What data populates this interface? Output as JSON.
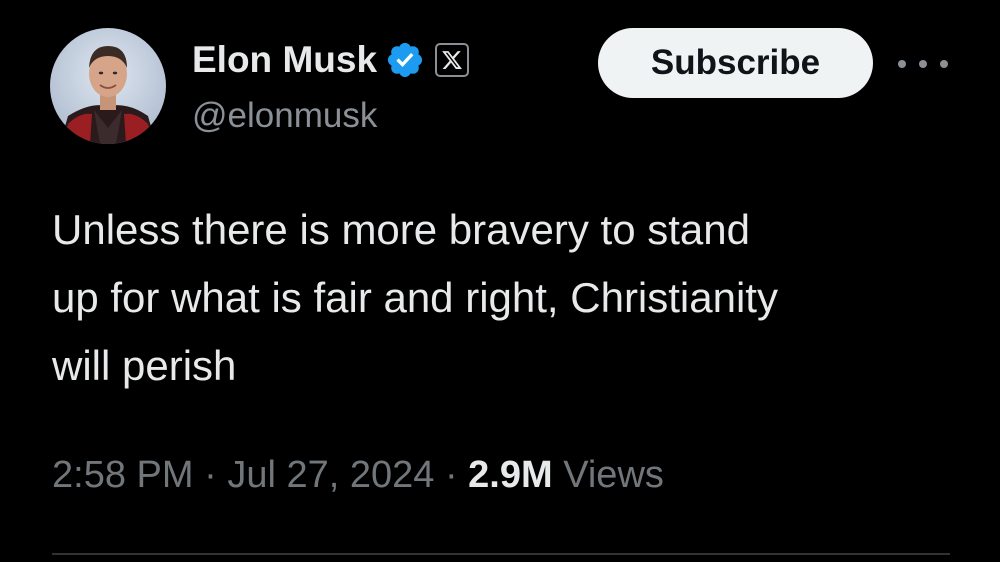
{
  "author": {
    "display_name": "Elon Musk",
    "handle": "@elonmusk",
    "avatar_icon": "profile-photo",
    "verified_icon": "verified-badge-icon",
    "affiliate_icon": "x-logo-icon"
  },
  "actions": {
    "subscribe_label": "Subscribe",
    "more_icon": "more-options-icon"
  },
  "tweet": {
    "lines": [
      "Unless there is more bravery to stand",
      "up for what is fair and right, Christianity",
      "will perish"
    ]
  },
  "meta": {
    "time": "2:58 PM",
    "separator": "·",
    "date": "Jul 27, 2024",
    "views_count": "2.9M",
    "views_label": "Views"
  },
  "colors": {
    "background": "#000000",
    "primary_text": "#e7e9ea",
    "secondary_text": "#71767b",
    "verified_blue": "#1d9bf0",
    "subscribe_bg": "#eff3f4",
    "divider": "#2f3336"
  }
}
